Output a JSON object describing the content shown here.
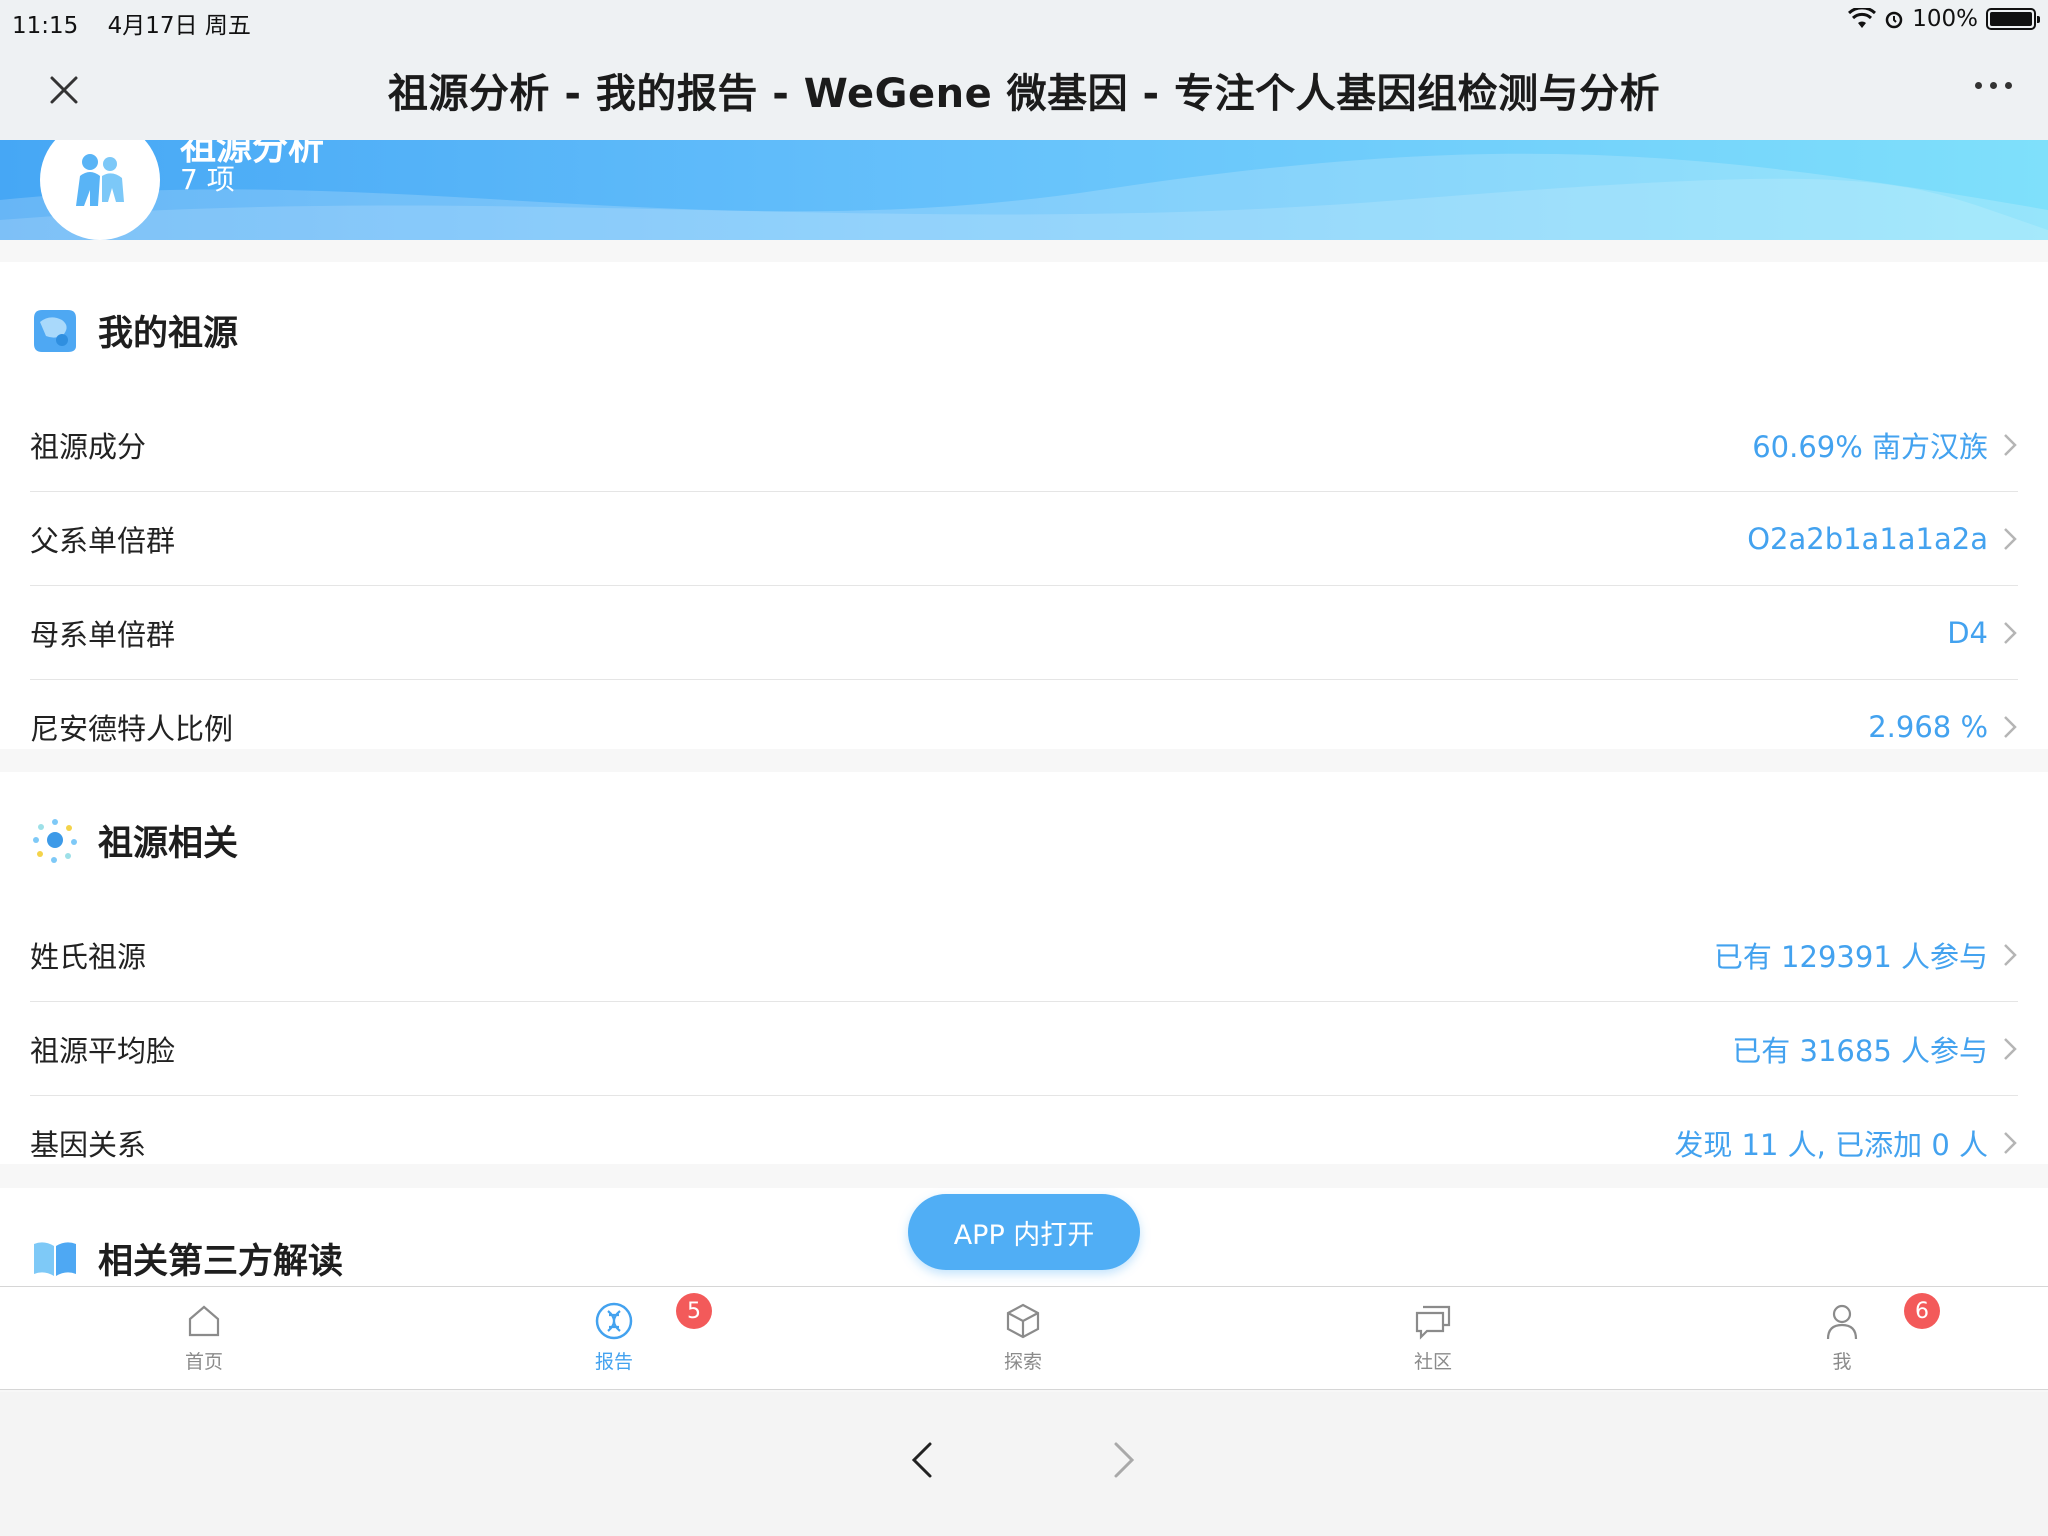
{
  "status_bar": {
    "time": "11:15",
    "date": "4月17日 周五",
    "battery": "100%"
  },
  "nav": {
    "title": "祖源分析 - 我的报告 - WeGene 微基因 - 专注个人基因组检测与分析"
  },
  "banner": {
    "title": "祖源分析",
    "count": "7 项"
  },
  "my_ancestry": {
    "title": "我的祖源",
    "rows": [
      {
        "label": "祖源成分",
        "value": "60.69% 南方汉族"
      },
      {
        "label": "父系单倍群",
        "value": "O2a2b1a1a1a2a"
      },
      {
        "label": "母系单倍群",
        "value": "D4"
      },
      {
        "label": "尼安德特人比例",
        "value": "2.968 %"
      }
    ]
  },
  "related": {
    "title": "祖源相关",
    "rows": [
      {
        "label": "姓氏祖源",
        "value": "已有 129391 人参与"
      },
      {
        "label": "祖源平均脸",
        "value": "已有 31685 人参与"
      },
      {
        "label": "基因关系",
        "value": "发现 11 人, 已添加 0 人"
      }
    ]
  },
  "third_party": {
    "title": "相关第三方解读"
  },
  "fab": {
    "label": "APP 内打开"
  },
  "tabs": [
    {
      "label": "首页",
      "icon": "home-icon"
    },
    {
      "label": "报告",
      "icon": "dna-icon",
      "badge": "5"
    },
    {
      "label": "探索",
      "icon": "cube-icon"
    },
    {
      "label": "社区",
      "icon": "chat-icon"
    },
    {
      "label": "我",
      "icon": "person-icon",
      "badge": "6"
    }
  ],
  "colors": {
    "accent": "#43a2ef",
    "badge": "#f35a5a",
    "fab": "#50aef5"
  }
}
